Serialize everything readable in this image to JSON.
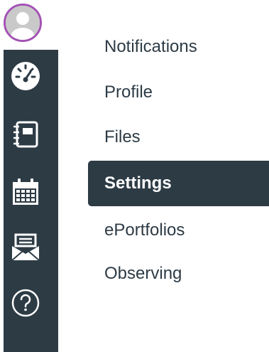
{
  "global_nav": {
    "items": [
      {
        "name": "account",
        "icon": "avatar-icon"
      },
      {
        "name": "dashboard",
        "icon": "dashboard-gauge-icon"
      },
      {
        "name": "courses",
        "icon": "notebook-icon"
      },
      {
        "name": "calendar",
        "icon": "calendar-icon"
      },
      {
        "name": "inbox",
        "icon": "inbox-envelope-icon"
      },
      {
        "name": "help",
        "icon": "help-question-icon"
      }
    ],
    "colors": {
      "rail": "#2d3b45",
      "avatar_ring": "#a352b3",
      "icon": "#ffffff"
    }
  },
  "account_menu": {
    "items": [
      {
        "label": "Notifications",
        "active": false
      },
      {
        "label": "Profile",
        "active": false
      },
      {
        "label": "Files",
        "active": false
      },
      {
        "label": "Settings",
        "active": true
      },
      {
        "label": "ePortfolios",
        "active": false
      },
      {
        "label": "Observing",
        "active": false
      }
    ]
  }
}
